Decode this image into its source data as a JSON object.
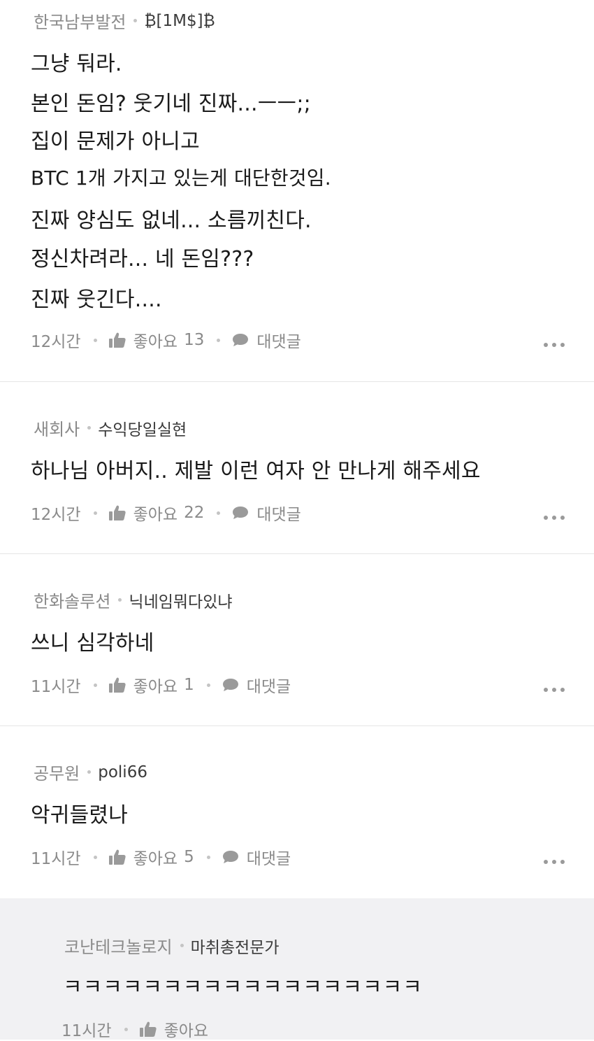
{
  "comments": [
    {
      "company": "한국남부발전",
      "nickname": "₿[1M$]₿",
      "lines": [
        "그냥 둬라.",
        "본인 돈임?  웃기네 진짜...ㅡㅡ;;",
        "집이 문제가 아니고",
        "BTC 1개 가지고 있는게 대단한것임.",
        "진짜 양심도 없네... 소름끼친다.",
        "정신차려라...  네 돈임???",
        "진짜 웃긴다...."
      ],
      "time": "12시간",
      "like_label": "좋아요",
      "like_count": "13",
      "reply_label": "대댓글"
    },
    {
      "company": "새회사",
      "nickname": "수익당일실현",
      "lines": [
        "하나님 아버지.. 제발 이런 여자 안 만나게 해주세요"
      ],
      "time": "12시간",
      "like_label": "좋아요",
      "like_count": "22",
      "reply_label": "대댓글"
    },
    {
      "company": "한화솔루션",
      "nickname": "닉네임뭐다있냐",
      "lines": [
        "쓰니 심각하네"
      ],
      "time": "11시간",
      "like_label": "좋아요",
      "like_count": "1",
      "reply_label": "대댓글"
    },
    {
      "company": "공무원",
      "nickname": "poli66",
      "lines": [
        "악귀들렸나"
      ],
      "time": "11시간",
      "like_label": "좋아요",
      "like_count": "5",
      "reply_label": "대댓글"
    }
  ],
  "reply": {
    "company": "코난테크놀로지",
    "nickname": "마취총전문가",
    "lines": [
      "ㅋㅋㅋㅋㅋㅋㅋㅋㅋㅋㅋㅋㅋㅋㅋㅋㅋㅋ"
    ],
    "time": "11시간",
    "like_label": "좋아요"
  },
  "icons": {
    "like": "thumbs-up-icon",
    "reply": "speech-bubble-icon",
    "more": "more-options-icon"
  },
  "colors": {
    "text_primary": "#1a1a1a",
    "text_secondary": "#8a8a8a",
    "reply_background": "#f1f1f3",
    "divider": "#e6e6e6"
  }
}
